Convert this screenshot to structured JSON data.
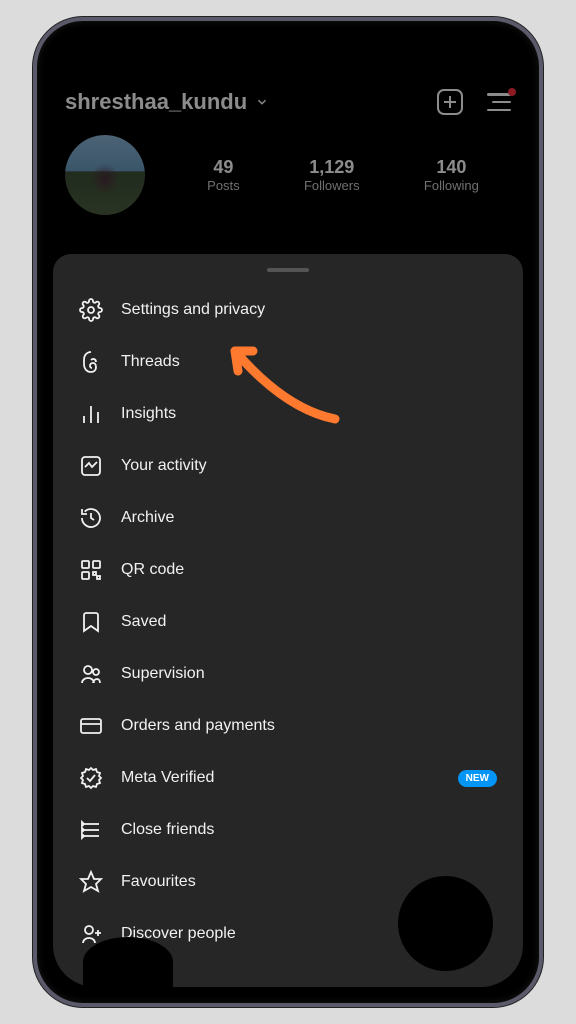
{
  "header": {
    "username": "shresthaa_kundu",
    "stats": {
      "posts_value": "49",
      "posts_label": "Posts",
      "followers_value": "1,129",
      "followers_label": "Followers",
      "following_value": "140",
      "following_label": "Following"
    }
  },
  "menu": {
    "items": [
      {
        "label": "Settings and privacy",
        "icon": "gear-icon"
      },
      {
        "label": "Threads",
        "icon": "threads-icon"
      },
      {
        "label": "Insights",
        "icon": "insights-icon"
      },
      {
        "label": "Your activity",
        "icon": "activity-icon"
      },
      {
        "label": "Archive",
        "icon": "archive-icon"
      },
      {
        "label": "QR code",
        "icon": "qr-icon"
      },
      {
        "label": "Saved",
        "icon": "saved-icon"
      },
      {
        "label": "Supervision",
        "icon": "supervision-icon"
      },
      {
        "label": "Orders and payments",
        "icon": "card-icon"
      },
      {
        "label": "Meta Verified",
        "icon": "verified-icon",
        "badge": "NEW"
      },
      {
        "label": "Close friends",
        "icon": "close-friends-icon"
      },
      {
        "label": "Favourites",
        "icon": "star-icon"
      },
      {
        "label": "Discover people",
        "icon": "discover-icon"
      }
    ]
  },
  "badge_text": "NEW",
  "annotation_color": "#ff7a2e"
}
